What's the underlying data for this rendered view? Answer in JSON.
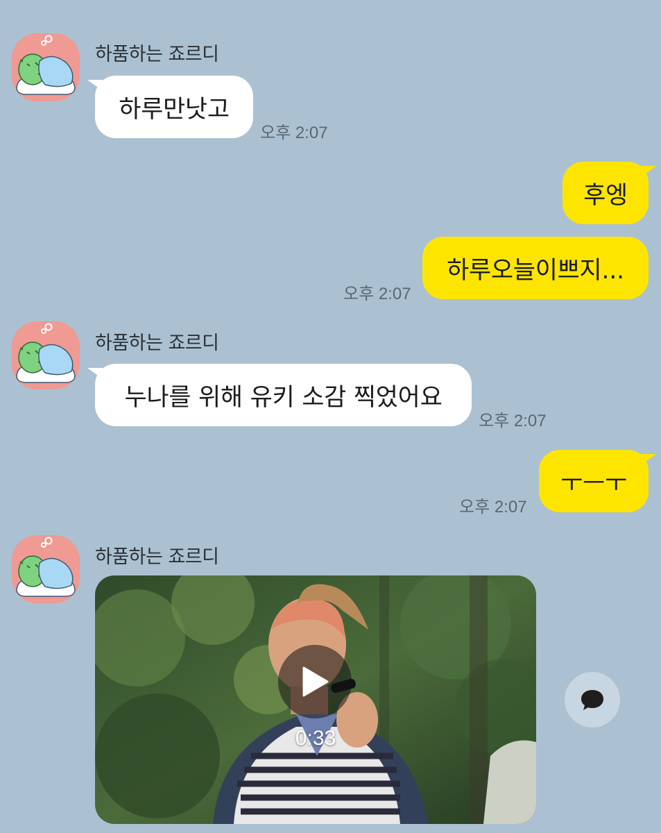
{
  "sender_name": "하품하는 죠르디",
  "colors": {
    "background": "#abc1d1",
    "incoming_bubble": "#ffffff",
    "outgoing_bubble": "#fee500",
    "avatar_bg": "#ef9a93"
  },
  "messages": [
    {
      "side": "incoming",
      "sender": "하품하는 죠르디",
      "text": "하루만낫고",
      "time": "오후 2:07"
    },
    {
      "side": "outgoing",
      "text": "후엥",
      "time": ""
    },
    {
      "side": "outgoing",
      "text": "하루오늘이쁘지...",
      "time": "오후 2:07"
    },
    {
      "side": "incoming",
      "sender": "하품하는 죠르디",
      "text": "누나를 위해 유키 소감 찍었어요",
      "time": "오후 2:07"
    },
    {
      "side": "outgoing",
      "text": "ㅜㅡㅜ",
      "time": "오후 2:07"
    },
    {
      "side": "incoming",
      "sender": "하품하는 죠르디",
      "type": "video",
      "duration": "0:33"
    }
  ],
  "icons": {
    "avatar": "jordy-sleeping-avatar-icon",
    "play": "play-icon",
    "share": "speech-bubble-icon"
  }
}
